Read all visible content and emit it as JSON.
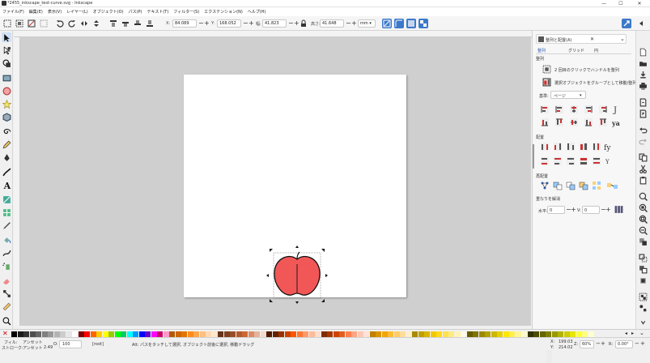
{
  "window": {
    "title": "*2455_inkscape_test-curve.svg - Inkscape",
    "minimize": "—",
    "maximize": "☐",
    "close": "✕"
  },
  "menu": [
    "ファイル(F)",
    "編集(E)",
    "表示(V)",
    "レイヤー(L)",
    "オブジェクト(O)",
    "パス(P)",
    "テキスト(T)",
    "フィルター(S)",
    "エクステンション(N)",
    "ヘルプ(H)"
  ],
  "toolbar": {
    "x_label": "X:",
    "x_value": "84.089",
    "y_label": "Y:",
    "y_value": "168.052",
    "w_label": "幅:",
    "w_value": "41.823",
    "h_label": "高さ:",
    "h_value": "41.648",
    "unit": "mm"
  },
  "panel": {
    "tab_title": "整列と配置(A)",
    "subtabs": [
      "整列",
      "グリッド",
      "円"
    ],
    "section_align": "整列",
    "opt_rel": "2 回目のクリックでハンドルを整列",
    "opt_group": "選択オブジェクトをグループとして移動/整列",
    "relative_label": "基準:",
    "relative_value": "ページ",
    "section_distribute": "配置",
    "section_rearrange": "再配置",
    "section_overlap": "重なりを解消",
    "hgap_label": "水平:",
    "hgap_value": "0",
    "vgap_label": "V:",
    "vgap_value": "0"
  },
  "status": {
    "fill_label": "フィル:",
    "fill_value": "アンセット",
    "stroke_label": "ストローク:",
    "stroke_value": "アンセット",
    "stroke_width": "2.49",
    "opacity_label": "O:",
    "opacity_value": "100",
    "layer": "[root]",
    "message": "Alt: パスをタッチして選択, オブジェクト前後に選択, 移動ドラッグ",
    "x_label": "X:",
    "x_value": "199.03",
    "y_label": "Y:",
    "y_value": "214.02",
    "z_label": "Z:",
    "zoom": "60%",
    "r_label": "R:",
    "rotation": "0.00°"
  },
  "colors": {
    "accent": "#3c79c9",
    "apple": "#f25757",
    "stroke": "#111111"
  },
  "palette": [
    "#000000",
    "#1a1a1a",
    "#333333",
    "#4d4d4d",
    "#666666",
    "#808080",
    "#999999",
    "#b3b3b3",
    "#cccccc",
    "#e6e6e6",
    "#ffffff",
    "#800000",
    "#ff0000",
    "#ff6600",
    "#ffcc00",
    "#ffff00",
    "#99cc00",
    "#00ff00",
    "#00cc66",
    "#00ffff",
    "#0099ff",
    "#0000ff",
    "#6600cc",
    "#ff00ff",
    "#cc0066",
    "#ff99cc",
    "#b35900",
    "#cc6600",
    "#e67300",
    "#ff8c1a",
    "#ffa64d",
    "#ffbf80",
    "#ffd9b3",
    "#ffe6cc",
    "#66331a",
    "#804020",
    "#994d26",
    "#b35a2d",
    "#cc6633",
    "#d98c66",
    "#e6b399",
    "#f2d9cc",
    "#4d1a00",
    "#662200",
    "#993300",
    "#cc4400",
    "#ff5500",
    "#ff7733",
    "#ff9966",
    "#ffbb99",
    "#ffddcc",
    "#802b00",
    "#a63700",
    "#cc4400",
    "#e65c1a",
    "#ff7f4d",
    "#ffa380",
    "#ffc7b3",
    "#ffe3d9",
    "#c08000",
    "#d99400",
    "#f2a600",
    "#ffbb33",
    "#ffcc66",
    "#ffdd99",
    "#ffeecc",
    "#a68a00",
    "#bf9f00",
    "#d9b400",
    "#f2c900",
    "#ffd91a",
    "#ffe14d",
    "#ffea80",
    "#fff2b3",
    "#fffae6",
    "#665c00",
    "#807300",
    "#998a00",
    "#b3a100",
    "#ccb800",
    "#e6cf00",
    "#ffe600",
    "#fff04d",
    "#fff599",
    "#fffacc",
    "#333300",
    "#4d4d00",
    "#666600",
    "#808000",
    "#999900",
    "#b3b300",
    "#cccc00",
    "#e6e600",
    "#ffff33",
    "#ffff80",
    "#ffffcc"
  ]
}
